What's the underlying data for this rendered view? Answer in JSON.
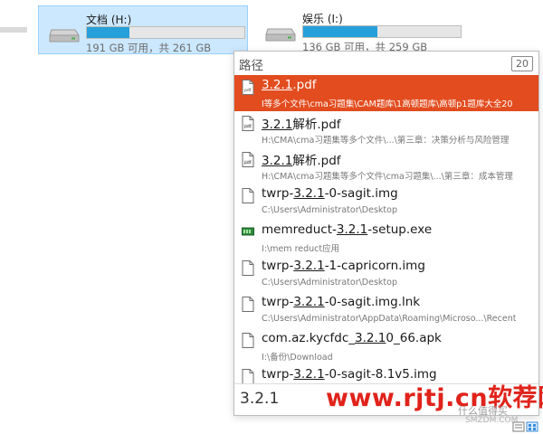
{
  "drives": [
    {
      "name": "文档 (H:)",
      "free": "191 GB 可用，共 261 GB",
      "used_fraction": 0.27,
      "selected": true
    },
    {
      "name": "娱乐 (I:)",
      "free": "136 GB 可用，共 259 GB",
      "used_fraction": 0.47,
      "selected": false
    }
  ],
  "popup": {
    "title": "路径",
    "count": "20",
    "query": "3.2.1"
  },
  "results": [
    {
      "pre": "",
      "hl": "3.2.1",
      "post": ".pdf",
      "path": "I等多个文件\\cma习题集\\CAM题库\\1高顿题库\\高顿p1题库大全20",
      "icon": "pdf-icon",
      "selected": true
    },
    {
      "pre": "",
      "hl": "3.2.1",
      "post": "解析.pdf",
      "path": "H:\\CMA\\cma习题集等多个文件\\...\\第三章：决策分析与风险管理",
      "icon": "pdf-icon",
      "selected": false
    },
    {
      "pre": "",
      "hl": "3.2.1",
      "post": "解析.pdf",
      "path": "H:\\CMA\\cma习题集等多个文件\\cma习题集\\...\\第三章：成本管理",
      "icon": "pdf-icon",
      "selected": false
    },
    {
      "pre": "twrp-",
      "hl": "3.2.1",
      "post": "-0-sagit.img",
      "path": "C:\\Users\\Administrator\\Desktop",
      "icon": "file-icon",
      "selected": false
    },
    {
      "pre": "memreduct-",
      "hl": "3.2.1",
      "post": "-setup.exe",
      "path": "I:\\mem reduct应用",
      "icon": "exe-icon",
      "selected": false
    },
    {
      "pre": "twrp-",
      "hl": "3.2.1",
      "post": "-1-capricorn.img",
      "path": "C:\\Users\\Administrator\\Desktop",
      "icon": "file-icon",
      "selected": false
    },
    {
      "pre": "twrp-",
      "hl": "3.2.1",
      "post": "-0-sagit.img.lnk",
      "path": "C:\\Users\\Administrator\\AppData\\Roaming\\Microso...\\Recent",
      "icon": "file-icon",
      "selected": false
    },
    {
      "pre": "com.az.kycfdc_",
      "hl": "3.2.1",
      "post": "0_66.apk",
      "path": "I:\\备份\\Download",
      "icon": "file-icon",
      "selected": false
    },
    {
      "pre": "twrp-",
      "hl": "3.2.1",
      "post": "-0-sagit-8.1v5.img",
      "path": "",
      "icon": "file-icon",
      "selected": false
    }
  ],
  "watermark": {
    "main": "www.rjtj.cn软荐网",
    "sub": "什么值得买",
    "sub2": "SMZDM.COM"
  },
  "colors": {
    "selected_row": "#e24c1f",
    "drive_bar": "#26a0da",
    "watermark": "#e0231b"
  }
}
